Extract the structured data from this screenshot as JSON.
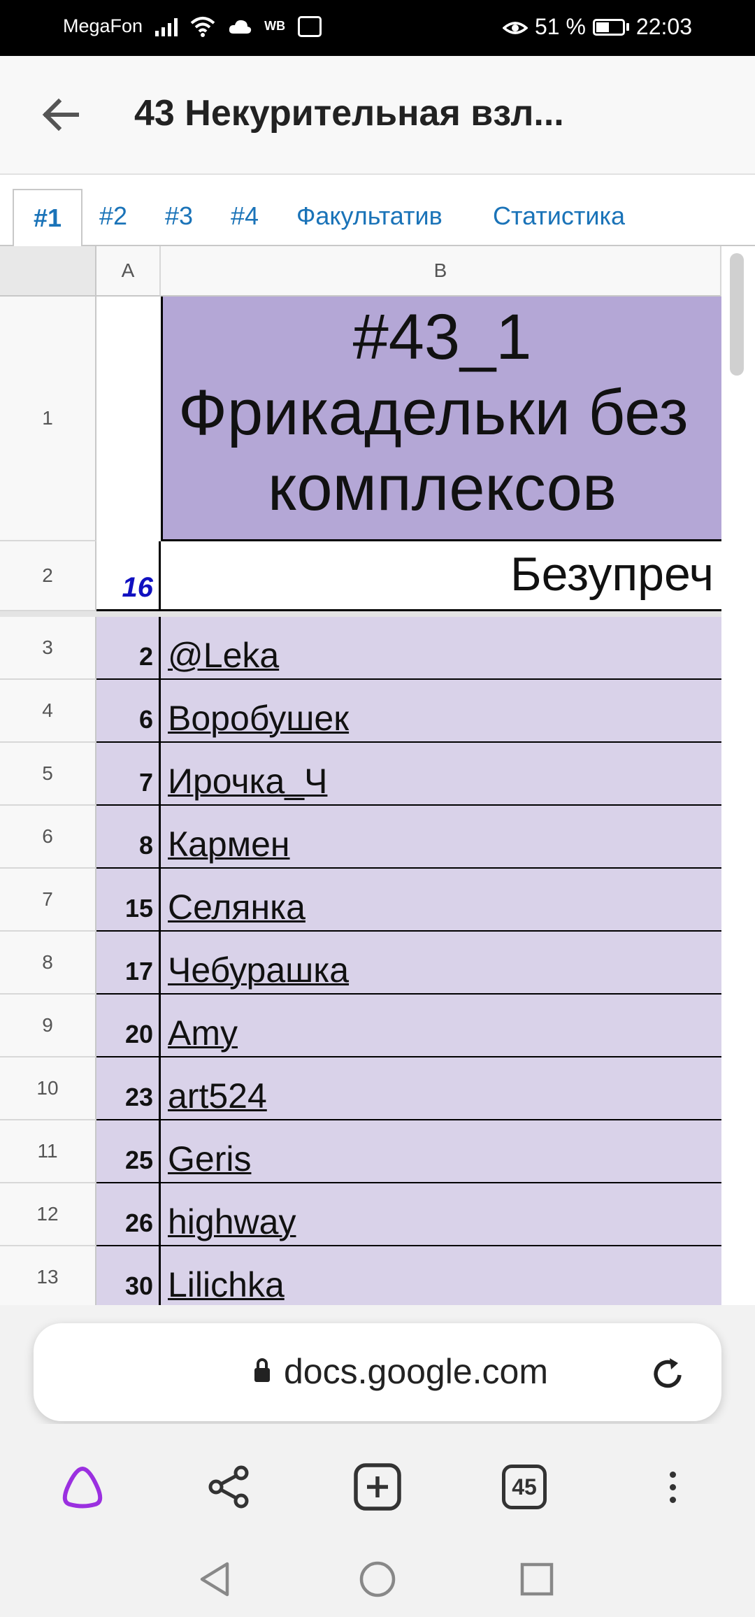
{
  "status_bar": {
    "carrier": "MegaFon",
    "extra": "WB",
    "battery": "51 %",
    "battery_level": 0.51,
    "time": "22:03"
  },
  "app_bar": {
    "title": "43 Некурительная взл..."
  },
  "sheet_tabs": [
    {
      "label": "#1",
      "active": true
    },
    {
      "label": "#2",
      "active": false
    },
    {
      "label": "#3",
      "active": false
    },
    {
      "label": "#4",
      "active": false
    },
    {
      "label": "Факультатив",
      "active": false
    },
    {
      "label": "Статистика",
      "active": false
    }
  ],
  "columns": [
    "A",
    "B"
  ],
  "title_cell": {
    "line1": "#43_1",
    "line2": "Фрикадельки без",
    "line3": "комплексов"
  },
  "row2": {
    "row_number": "2",
    "a_value": "16",
    "b_value": "Безупреч"
  },
  "row1_number": "1",
  "rows": [
    {
      "row": "3",
      "num": "2",
      "name": "@Leka"
    },
    {
      "row": "4",
      "num": "6",
      "name": "Воробушек"
    },
    {
      "row": "5",
      "num": "7",
      "name": "Ирочка_Ч"
    },
    {
      "row": "6",
      "num": "8",
      "name": "Кармен"
    },
    {
      "row": "7",
      "num": "15",
      "name": "Селянка"
    },
    {
      "row": "8",
      "num": "17",
      "name": "Чебурашка"
    },
    {
      "row": "9",
      "num": "20",
      "name": "Amy"
    },
    {
      "row": "10",
      "num": "23",
      "name": "art524"
    },
    {
      "row": "11",
      "num": "25",
      "name": "Geris"
    },
    {
      "row": "12",
      "num": "26",
      "name": "highway"
    },
    {
      "row": "13",
      "num": "30",
      "name": "Lilichka"
    }
  ],
  "address_bar": {
    "url": "docs.google.com"
  },
  "toolbar": {
    "tabs_count": "45"
  },
  "colors": {
    "title_fill": "#b4a7d6",
    "row_fill": "#d9d2e9",
    "tab_link": "#1a73b8",
    "a2_text": "#1010c0",
    "assistant_accent": "#9b30e0"
  }
}
